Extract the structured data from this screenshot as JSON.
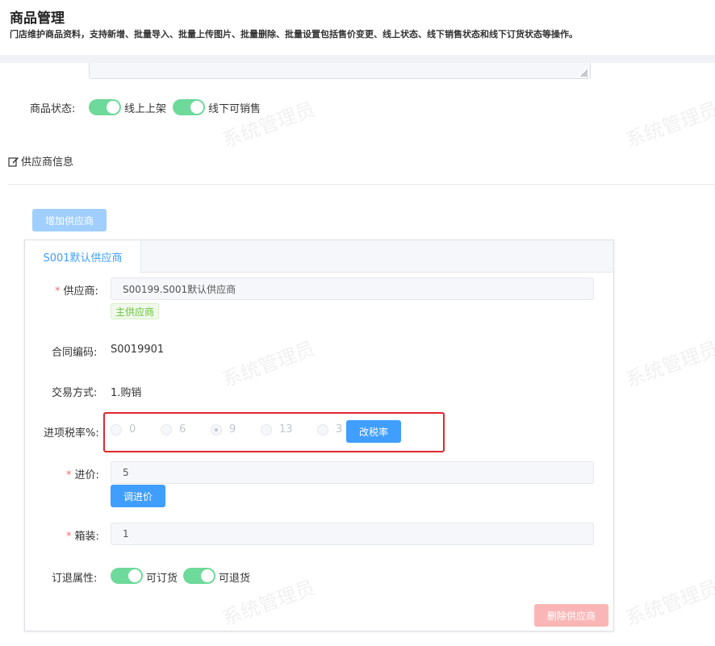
{
  "header": {
    "title": "商品管理",
    "description": "门店维护商品资料，支持新增、批量导入、批量上传图片、批量删除、批量设置包括售价变更、线上状态、线下销售状态和线下订货状态等操作。"
  },
  "product_status": {
    "label": "商品状态:",
    "online_label": "线上上架",
    "offline_label": "线下可销售",
    "online_on": true,
    "offline_on": true
  },
  "supplier_section": {
    "heading": "供应商信息",
    "add_button": "增加供应商"
  },
  "supplier_tab": {
    "tab_label": "S001默认供应商",
    "supplier_label": "供应商:",
    "supplier_value": "S00199.S001默认供应商",
    "main_tag": "主供应商",
    "contract_label": "合同编码:",
    "contract_value": "S0019901",
    "trade_label": "交易方式:",
    "trade_value": "1.购销",
    "tax_label": "进项税率%:",
    "tax_options": [
      "0",
      "6",
      "9",
      "13",
      "3"
    ],
    "tax_selected": "9",
    "change_tax_button": "改税率",
    "price_label": "进价:",
    "price_value": "5",
    "adjust_price_button": "调进价",
    "box_label": "箱装:",
    "box_value": "1",
    "order_attr_label": "订退属性:",
    "can_order_label": "可订货",
    "can_return_label": "可退货",
    "can_order_on": true,
    "can_return_on": true,
    "delete_button": "删除供应商"
  },
  "watermark_text": "系统管理员",
  "colors": {
    "primary": "#409eff",
    "switch_on": "#6dd99a",
    "danger": "#f56c6c",
    "highlight": "#e0282d",
    "tag_green": "#67c23a"
  }
}
